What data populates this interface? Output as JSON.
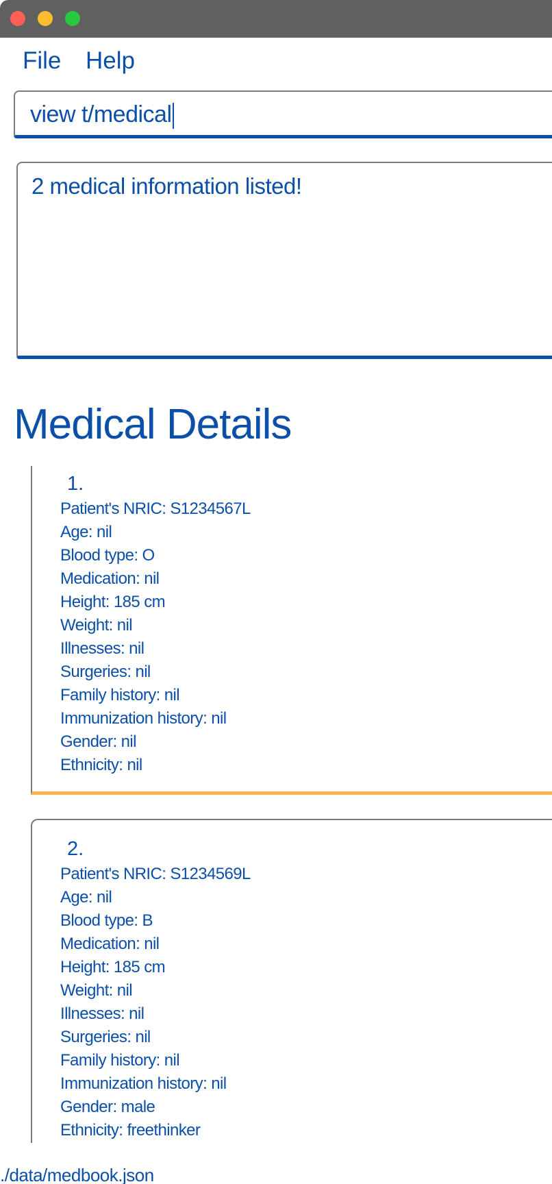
{
  "window": {
    "controls": [
      "close",
      "minimize",
      "zoom"
    ],
    "colors": {
      "close": "#fe5f57",
      "minimize": "#febc2e",
      "zoom": "#28c840"
    }
  },
  "menu": {
    "file": "File",
    "help": "Help"
  },
  "command": {
    "value": "view t/medical"
  },
  "result": {
    "message": "2 medical information listed!"
  },
  "section": {
    "title": "Medical Details"
  },
  "records": [
    {
      "index": "1.",
      "fields": [
        "Patient's NRIC: S1234567L",
        "Age: nil",
        "Blood type: O",
        "Medication: nil",
        "Height: 185 cm",
        "Weight: nil",
        "Illnesses: nil",
        "Surgeries: nil",
        "Family history: nil",
        "Immunization history: nil",
        "Gender: nil",
        "Ethnicity: nil"
      ]
    },
    {
      "index": "2.",
      "fields": [
        "Patient's NRIC: S1234569L",
        "Age: nil",
        "Blood type: B",
        "Medication: nil",
        "Height: 185 cm",
        "Weight: nil",
        "Illnesses: nil",
        "Surgeries: nil",
        "Family history: nil",
        "Immunization history: nil",
        "Gender: male",
        "Ethnicity: freethinker"
      ]
    }
  ],
  "status": {
    "file_path": "./data/medbook.json"
  },
  "colors": {
    "accent": "#0b4fa8",
    "selected_border": "#f9b44f",
    "titlebar": "#606060"
  }
}
